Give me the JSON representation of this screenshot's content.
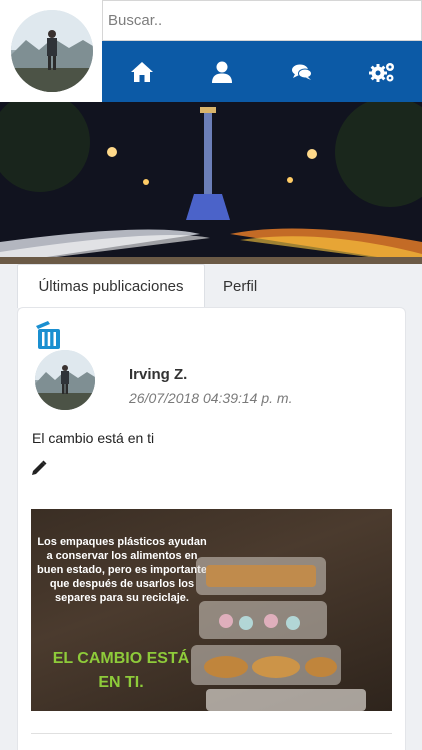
{
  "search": {
    "placeholder": "Buscar.."
  },
  "nav": {
    "items": [
      {
        "name": "home",
        "icon": "home-icon"
      },
      {
        "name": "profile",
        "icon": "user-icon"
      },
      {
        "name": "messages",
        "icon": "comments-icon"
      },
      {
        "name": "settings",
        "icon": "gears-icon"
      }
    ],
    "color": "#0c5aa6"
  },
  "tabs": {
    "active": "Últimas publicaciones",
    "inactive": "Perfil"
  },
  "post": {
    "author": "Irving Z.",
    "date": "26/07/2018 04:39:14 p. m.",
    "text": "El cambio está en ti",
    "image_text": "Los empaques plásticos ayudan a conservar los alimentos en buen estado, pero es importante que después de usarlos los separes para su reciclaje.",
    "image_slogan": "EL CAMBIO ESTÁ EN TI."
  },
  "colors": {
    "accent": "#0c5aa6",
    "trash": "#1a8fd0",
    "slogan": "#8ecb3a"
  }
}
